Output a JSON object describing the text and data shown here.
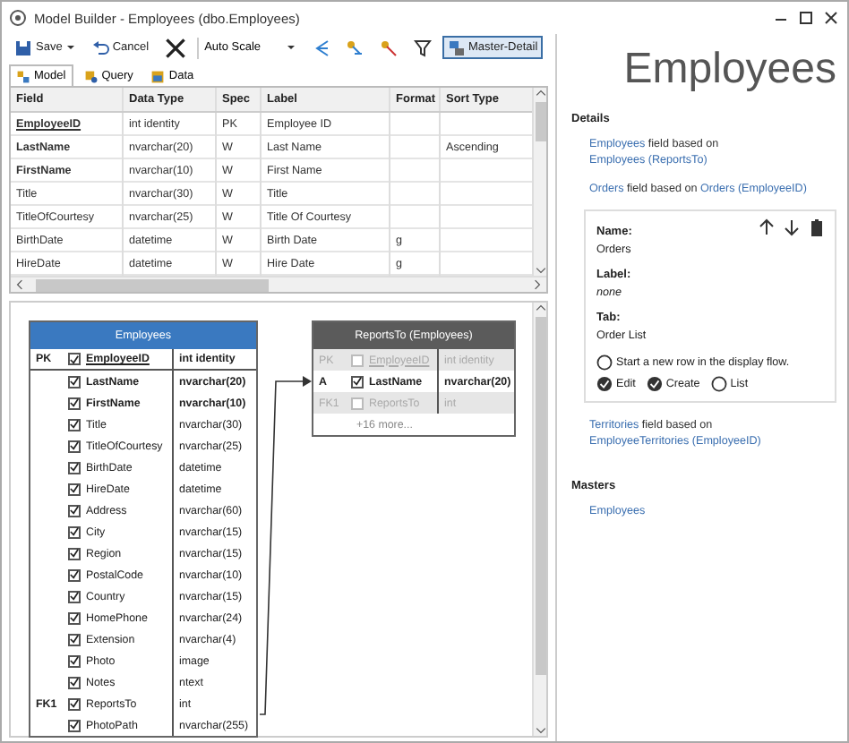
{
  "window": {
    "title": "Model Builder - Employees (dbo.Employees)"
  },
  "toolbar": [
    {
      "kind": "button",
      "label": "Save",
      "menu": true,
      "selected": false
    },
    {
      "kind": "button",
      "label": "Cancel",
      "menu": false,
      "selected": false
    },
    {
      "kind": "icon",
      "selected": false
    },
    {
      "kind": "select",
      "label": "Auto Scale"
    },
    {
      "kind": "icon",
      "selected": false
    },
    {
      "kind": "icon",
      "selected": false
    },
    {
      "kind": "icon",
      "selected": false
    },
    {
      "kind": "icon",
      "selected": false
    },
    {
      "kind": "button",
      "label": "Master-Detail",
      "menu": false,
      "selected": true
    }
  ],
  "tabs": [
    {
      "label": "Model",
      "selected": true
    },
    {
      "label": "Query",
      "selected": false
    },
    {
      "label": "Data",
      "selected": false
    }
  ],
  "grid": {
    "columns": [
      "Field",
      "Data Type",
      "Spec",
      "Label",
      "Format",
      "Sort Type"
    ],
    "rows": [
      {
        "kind": "key",
        "cells": [
          "EmployeeID",
          "int identity",
          "PK",
          "Employee ID",
          "",
          ""
        ]
      },
      {
        "kind": "required",
        "cells": [
          "LastName",
          "nvarchar(20)",
          "W",
          "Last Name",
          "",
          "Ascending"
        ]
      },
      {
        "kind": "required",
        "cells": [
          "FirstName",
          "nvarchar(10)",
          "W",
          "First Name",
          "",
          ""
        ]
      },
      {
        "kind": "normal",
        "cells": [
          "Title",
          "nvarchar(30)",
          "W",
          "Title",
          "",
          ""
        ]
      },
      {
        "kind": "normal",
        "cells": [
          "TitleOfCourtesy",
          "nvarchar(25)",
          "W",
          "Title Of Courtesy",
          "",
          ""
        ]
      },
      {
        "kind": "normal",
        "cells": [
          "BirthDate",
          "datetime",
          "W",
          "Birth Date",
          "g",
          ""
        ]
      },
      {
        "kind": "normal",
        "cells": [
          "HireDate",
          "datetime",
          "W",
          "Hire Date",
          "g",
          ""
        ]
      }
    ]
  },
  "diagram": {
    "tables": [
      {
        "title": "Employees",
        "kind": "main",
        "rows": [
          {
            "key": "PK",
            "checked": true,
            "name": "EmployeeID",
            "type": "int identity",
            "kind": "key"
          },
          {
            "key": "",
            "checked": true,
            "name": "LastName",
            "type": "nvarchar(20)",
            "kind": "required"
          },
          {
            "key": "",
            "checked": true,
            "name": "FirstName",
            "type": "nvarchar(10)",
            "kind": "required"
          },
          {
            "key": "",
            "checked": true,
            "name": "Title",
            "type": "nvarchar(30)",
            "kind": "normal"
          },
          {
            "key": "",
            "checked": true,
            "name": "TitleOfCourtesy",
            "type": "nvarchar(25)",
            "kind": "normal"
          },
          {
            "key": "",
            "checked": true,
            "name": "BirthDate",
            "type": "datetime",
            "kind": "normal"
          },
          {
            "key": "",
            "checked": true,
            "name": "HireDate",
            "type": "datetime",
            "kind": "normal"
          },
          {
            "key": "",
            "checked": true,
            "name": "Address",
            "type": "nvarchar(60)",
            "kind": "normal"
          },
          {
            "key": "",
            "checked": true,
            "name": "City",
            "type": "nvarchar(15)",
            "kind": "normal"
          },
          {
            "key": "",
            "checked": true,
            "name": "Region",
            "type": "nvarchar(15)",
            "kind": "normal"
          },
          {
            "key": "",
            "checked": true,
            "name": "PostalCode",
            "type": "nvarchar(10)",
            "kind": "normal"
          },
          {
            "key": "",
            "checked": true,
            "name": "Country",
            "type": "nvarchar(15)",
            "kind": "normal"
          },
          {
            "key": "",
            "checked": true,
            "name": "HomePhone",
            "type": "nvarchar(24)",
            "kind": "normal"
          },
          {
            "key": "",
            "checked": true,
            "name": "Extension",
            "type": "nvarchar(4)",
            "kind": "normal"
          },
          {
            "key": "",
            "checked": true,
            "name": "Photo",
            "type": "image",
            "kind": "normal"
          },
          {
            "key": "",
            "checked": true,
            "name": "Notes",
            "type": "ntext",
            "kind": "normal"
          },
          {
            "key": "FK1",
            "checked": true,
            "name": "ReportsTo",
            "type": "int",
            "kind": "normal"
          },
          {
            "key": "",
            "checked": true,
            "name": "PhotoPath",
            "type": "nvarchar(255)",
            "kind": "normal"
          }
        ]
      },
      {
        "title": "ReportsTo (Employees)",
        "kind": "lookup",
        "more": "+16 more...",
        "rows": [
          {
            "key": "PK",
            "checked": false,
            "name": "EmployeeID",
            "type": "int identity",
            "kind": "disabled"
          },
          {
            "key": "A",
            "checked": true,
            "name": "LastName",
            "type": "nvarchar(20)",
            "kind": "required"
          },
          {
            "key": "FK1",
            "checked": false,
            "name": "ReportsTo",
            "type": "int",
            "kind": "disabled"
          }
        ]
      }
    ]
  },
  "side": {
    "heading": "Employees",
    "details_title": "Details",
    "relations": [
      [
        {
          "text": "Employees",
          "link": true
        },
        {
          "text": " field based on ",
          "link": false
        },
        {
          "text": "Employees (ReportsTo)",
          "link": true
        }
      ],
      [
        {
          "text": "Orders",
          "link": true
        },
        {
          "text": " field based on ",
          "link": false
        },
        {
          "text": "Orders (EmployeeID)",
          "link": true
        }
      ]
    ],
    "editor": {
      "name_label": "Name:",
      "name_value": "Orders",
      "label_label": "Label:",
      "label_value": "none",
      "tab_label": "Tab:",
      "tab_value": "Order List",
      "new_row": {
        "label": "Start a new row in the display flow.",
        "checked": false
      },
      "options": [
        {
          "label": "Edit",
          "checked": true
        },
        {
          "label": "Create",
          "checked": true
        },
        {
          "label": "List",
          "checked": false
        }
      ]
    },
    "more_relations": [
      [
        {
          "text": "Territories",
          "link": true
        },
        {
          "text": " field based on ",
          "link": false
        },
        {
          "text": "EmployeeTerritories (EmployeeID)",
          "link": true
        }
      ]
    ],
    "masters_title": "Masters",
    "masters": [
      "Employees"
    ]
  }
}
